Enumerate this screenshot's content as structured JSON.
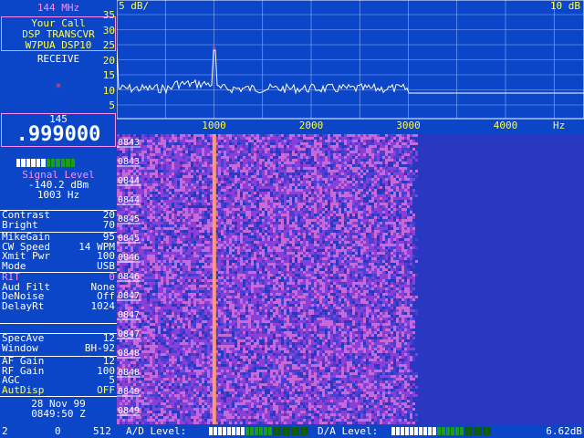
{
  "band": "144 MHz",
  "call_box": {
    "line1": "Your Call",
    "line2": "DSP TRANSCVR",
    "line3": "W7PUA DSP10"
  },
  "mode_status": "RECEIVE",
  "indicator": "*",
  "frequency": {
    "mhz": "145",
    "khz": ".999000"
  },
  "signal": {
    "label": "Signal Level",
    "dbm": "-140.2 dBm",
    "hz": "1003 Hz",
    "meter_fraction": 0.5
  },
  "display_settings": [
    {
      "label": "Contrast",
      "value": "20"
    },
    {
      "label": "Bright",
      "value": "70"
    }
  ],
  "tx_settings": [
    {
      "label": "MikeGain",
      "value": "95"
    },
    {
      "label": "CW Speed",
      "value": "14 WPM"
    },
    {
      "label": "Xmit Pwr",
      "value": "100"
    },
    {
      "label": "Mode",
      "value": "USB"
    }
  ],
  "rx_settings": [
    {
      "label": "RIT",
      "value": "0"
    },
    {
      "label": "Aud Filt",
      "value": "None"
    },
    {
      "label": "DeNoise",
      "value": "Off"
    },
    {
      "label": "DelayRt",
      "value": "1024"
    }
  ],
  "spectrum_settings": [
    {
      "label": "SpecAve",
      "value": "12"
    },
    {
      "label": "Window",
      "value": "BH-92"
    }
  ],
  "audio_settings": [
    {
      "label": "AF Gain",
      "value": "12"
    },
    {
      "label": "RF Gain",
      "value": "100"
    },
    {
      "label": "AGC",
      "value": "5"
    },
    {
      "label": "AutDisp",
      "value": "OFF"
    }
  ],
  "datetime": {
    "date": "28 Nov 99",
    "time": "0849:50 Z"
  },
  "spectrum": {
    "scale_left": "5 dB/",
    "scale_right": "10 dB",
    "y_ticks": [
      "35",
      "30",
      "25",
      "20",
      "15",
      "10",
      "5"
    ],
    "x_ticks": [
      "1000",
      "2000",
      "3000",
      "4000"
    ],
    "x_unit": "Hz",
    "peak_hz": 1003,
    "passband_hz": 3000
  },
  "waterfall": {
    "time_marks": [
      "0843",
      "0843",
      "0844",
      "0844",
      "0845",
      "0845",
      "0846",
      "0846",
      "0847",
      "0847",
      "0847",
      "0848",
      "0848",
      "0849",
      "0849"
    ]
  },
  "status_bar": {
    "n1": "2",
    "n2": "0",
    "n3": "512",
    "ad_label": "A/D Level:",
    "da_label": "D/A Level:",
    "gain": "6.62dB"
  },
  "colors": {
    "background": "#0b45c8",
    "accent_pink": "#ff8cff",
    "accent_yellow": "#ffff55",
    "meter_green": "#1c9c1c",
    "waterfall_signal": "#ff9a70"
  }
}
